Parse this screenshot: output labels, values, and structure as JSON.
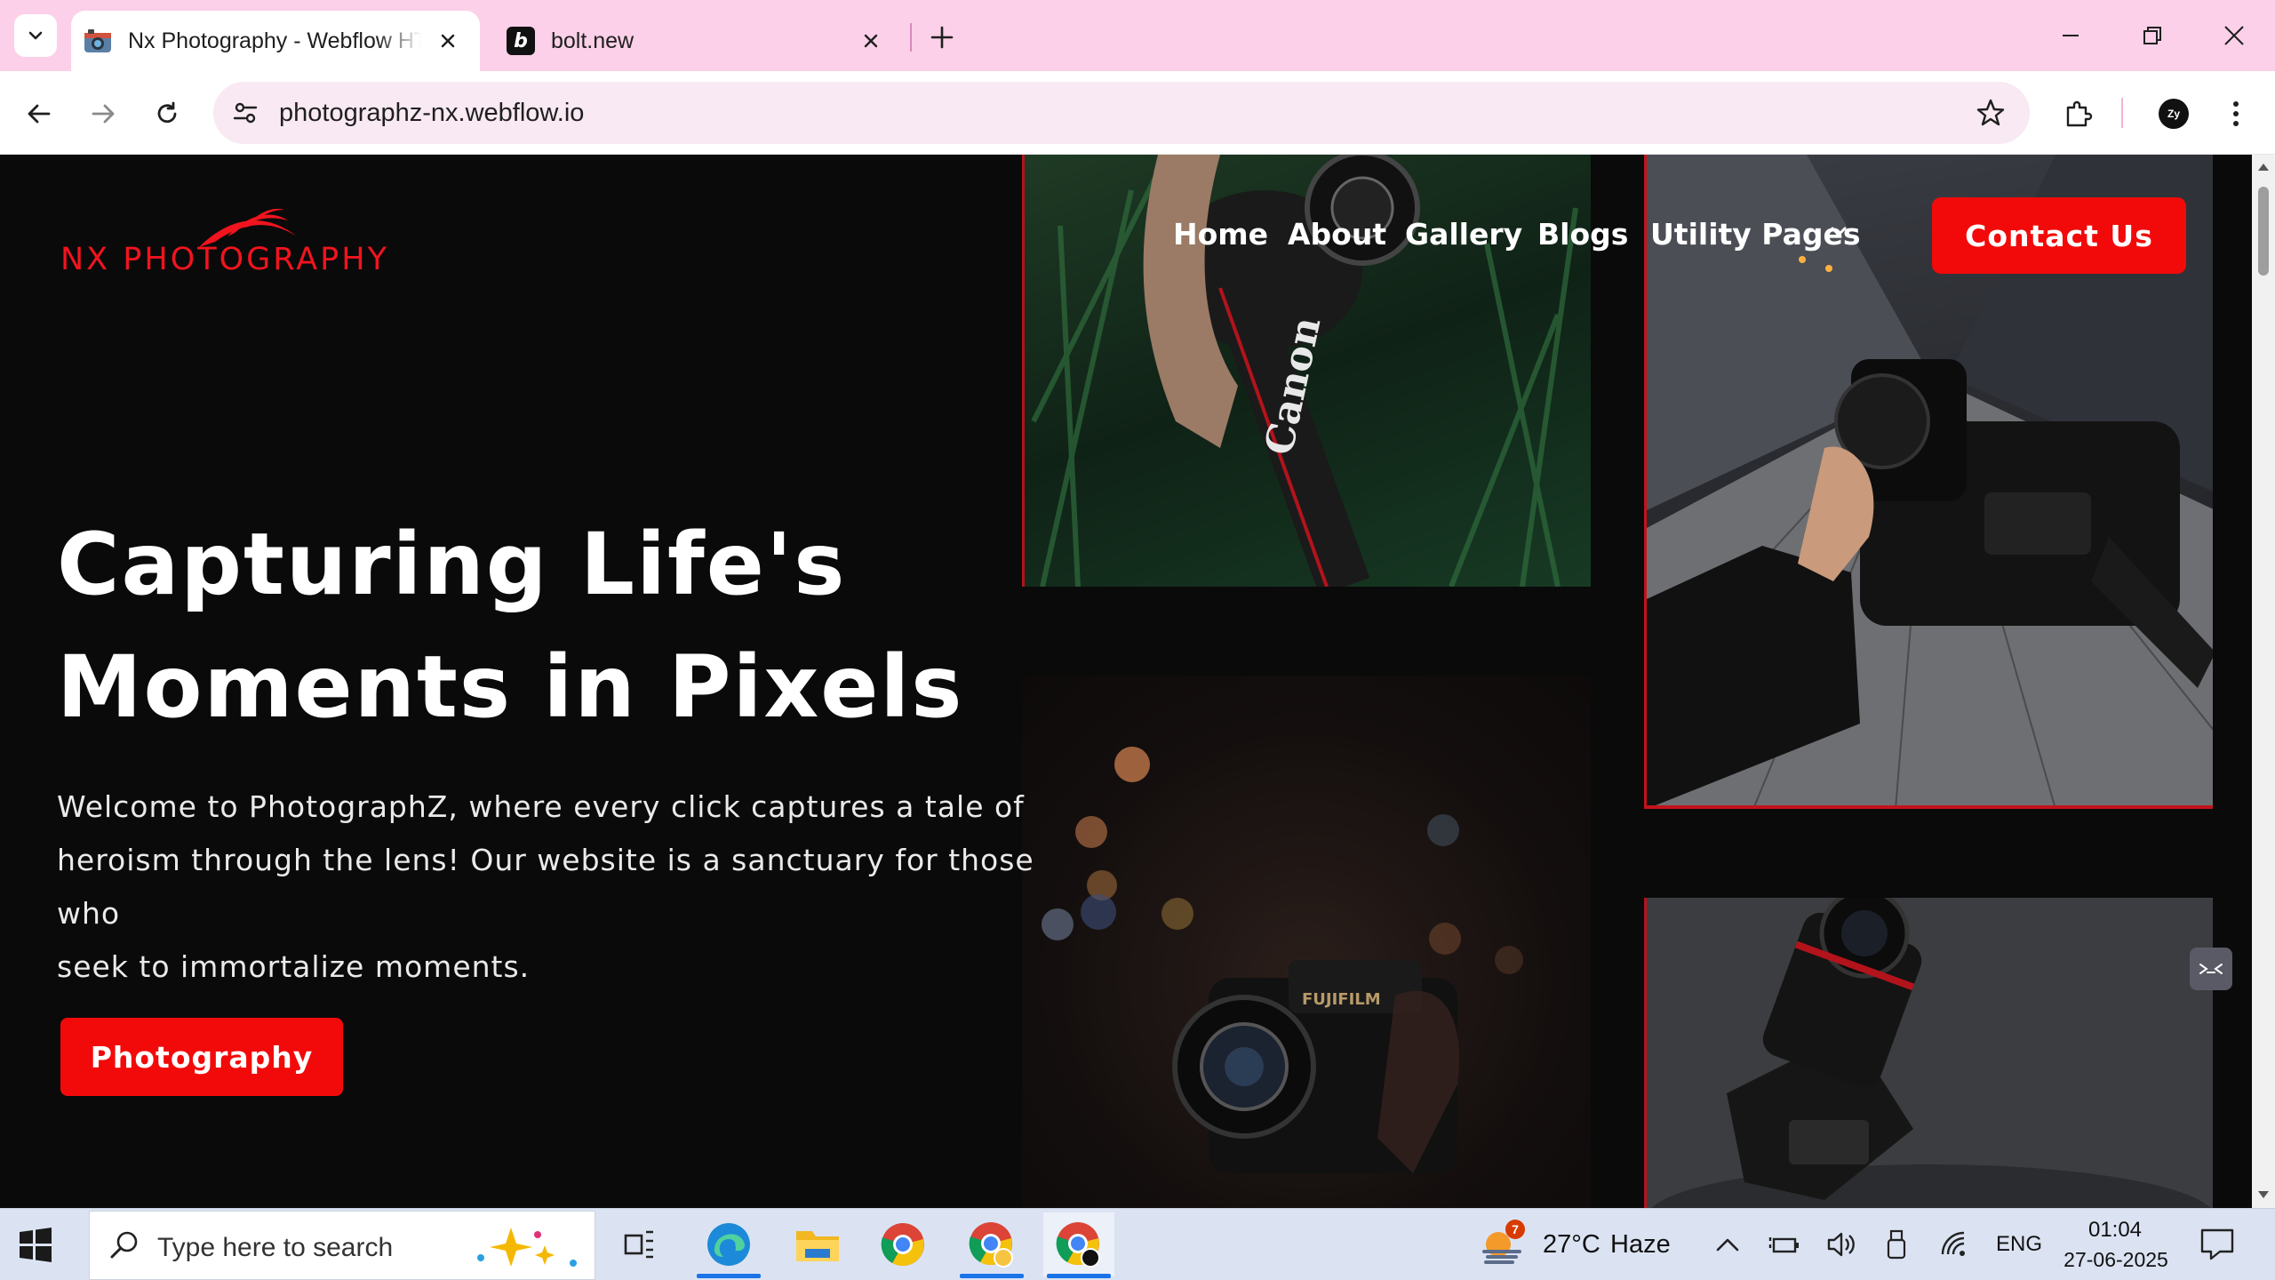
{
  "browser": {
    "tabs": [
      {
        "title": "Nx Photography - Webflow HTML",
        "active": true
      },
      {
        "title": "bolt.new",
        "active": false
      }
    ],
    "url": "photographz-nx.webflow.io",
    "profile_initials": "Zy"
  },
  "site": {
    "logo_text": "NX PHOTOGRAPHY",
    "nav": [
      "Home",
      "About",
      "Gallery",
      "Blogs",
      "Utility Pages"
    ],
    "contact_label": "Contact Us",
    "hero_title_line1": "Capturing Life's",
    "hero_title_line2": "Moments in Pixels",
    "hero_desc_line1": "Welcome to PhotographZ, where every click captures a tale of",
    "hero_desc_line2": "heroism through the lens! Our website is a sanctuary for those who",
    "hero_desc_line3": "seek to immortalize moments.",
    "cta_label": "Photography",
    "photo_text": {
      "camera_brand": "Canon",
      "fuji_brand": "FUJIFILM"
    }
  },
  "taskbar": {
    "search_placeholder": "Type here to search",
    "weather_badge": "7",
    "temperature": "27°C",
    "condition": "Haze",
    "language": "ENG",
    "time": "01:04",
    "date": "27-06-2025"
  },
  "colors": {
    "accent_red": "#f20a0a",
    "tab_strip": "#fbd0e8",
    "page_bg": "#0a0a0a",
    "taskbar": "#dbe3f3"
  },
  "icons": [
    "tab-search-icon",
    "camera-favicon",
    "bolt-favicon",
    "close-icon",
    "new-tab-icon",
    "minimize-icon",
    "restore-icon",
    "window-close-icon",
    "back-icon",
    "forward-icon",
    "reload-icon",
    "site-info-icon",
    "star-icon",
    "extensions-icon",
    "menu-icon",
    "chevron-down-icon",
    "windows-start-icon",
    "search-icon",
    "copilot-icon",
    "task-view-icon",
    "edge-icon",
    "file-explorer-icon",
    "chrome-icon",
    "weather-icon",
    "chevron-up-icon",
    "battery-icon",
    "volume-icon",
    "usb-icon",
    "wifi-icon",
    "notification-icon"
  ]
}
